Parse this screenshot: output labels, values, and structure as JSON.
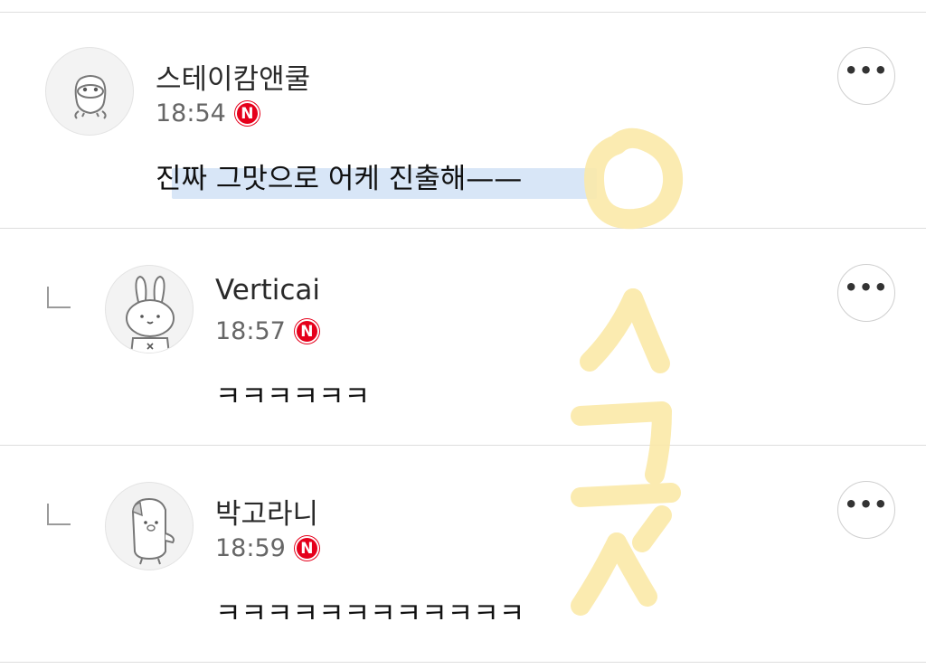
{
  "comments": [
    {
      "author": "스테이캄앤쿨",
      "time": "18:54",
      "badge": "N",
      "text": "진짜 그맛으로 어케 진출해——",
      "more_label": "•••",
      "avatar_icon": "duck-avatar-icon"
    },
    {
      "author": "Verticai",
      "time": "18:57",
      "badge": "N",
      "text": "ㅋㅋㅋㅋㅋㅋ",
      "more_label": "•••",
      "avatar_icon": "rabbit-avatar-icon",
      "is_reply": true
    },
    {
      "author": "박고라니",
      "time": "18:59",
      "badge": "N",
      "text": "ㅋㅋㅋㅋㅋㅋㅋㅋㅋㅋㅋㅋ",
      "more_label": "•••",
      "avatar_icon": "penguin-avatar-icon",
      "is_reply": true
    }
  ],
  "colors": {
    "badge": "#e5001b",
    "highlight": "#d8e6f7",
    "watermark": "#fbe9a8"
  },
  "watermark_icon": "handwritten-watermark-icon"
}
